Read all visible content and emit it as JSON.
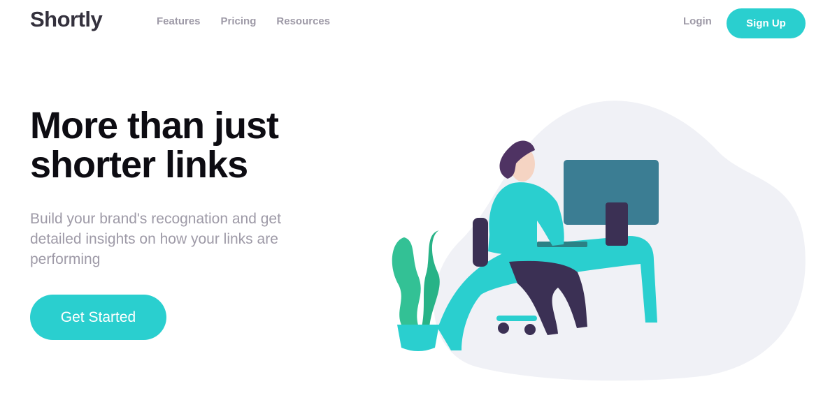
{
  "header": {
    "logo": "Shortly",
    "nav": [
      "Features",
      "Pricing",
      "Resources"
    ],
    "login": "Login",
    "signup": "Sign Up"
  },
  "hero": {
    "title_line1": "More than just",
    "title_line2": "shorter links",
    "subtitle": "Build your brand's recognation and get detailed insights on how your links are performing",
    "cta": "Get Started"
  },
  "colors": {
    "accent": "#2acfcf",
    "text_dark": "#0d0c12",
    "text_muted": "#9e9aa7",
    "blob": "#f0f1f6"
  },
  "icons": [
    "person-working-illustration"
  ]
}
